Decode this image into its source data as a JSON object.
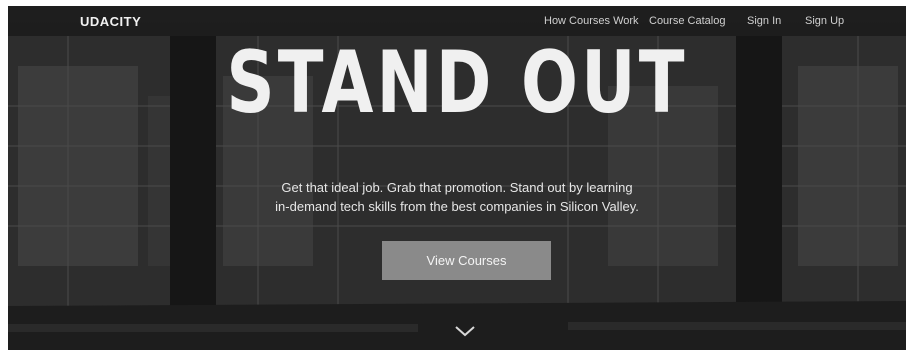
{
  "navbar": {
    "logo": "UDACITY",
    "links": [
      "How Courses Work",
      "Course Catalog",
      "Sign In",
      "Sign Up"
    ]
  },
  "hero": {
    "title": "STAND OUT",
    "subtitle_line1": "Get that ideal job. Grab that promotion. Stand out by learning",
    "subtitle_line2": "in-demand tech skills from the best companies in Silicon Valley.",
    "cta_label": "View Courses"
  },
  "icons": {
    "scroll": "chevron-down-icon"
  },
  "colors": {
    "navbar_bg": "#141414",
    "cta_bg": "#8a8a8a",
    "text": "#f0f0f0"
  }
}
